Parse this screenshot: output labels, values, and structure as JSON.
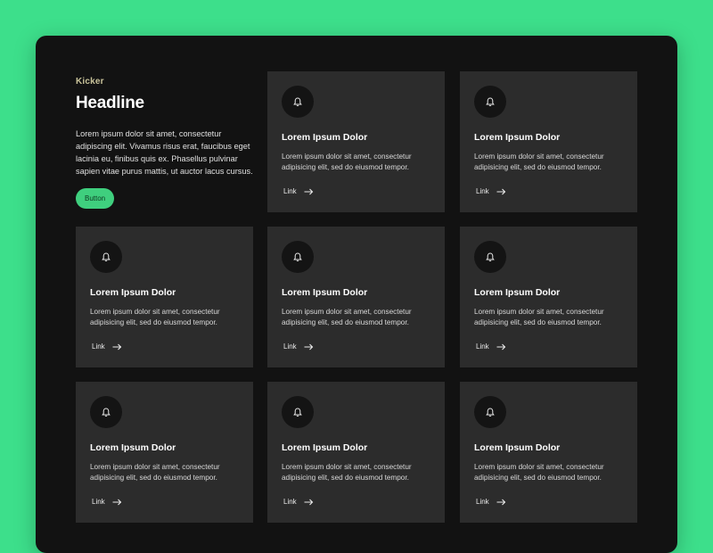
{
  "intro": {
    "kicker": "Kicker",
    "headline": "Headline",
    "body": "Lorem ipsum dolor sit amet, consectetur adipiscing elit. Vivamus risus erat, faucibus eget lacinia eu, finibus quis ex. Phasellus pulvinar sapien vitae purus mattis, ut auctor lacus cursus.",
    "button_label": "Button"
  },
  "colors": {
    "background": "#3ddf8b",
    "frame": "#121212",
    "card": "#2c2c2c",
    "accent": "#3fcf7e",
    "kicker": "#c9c39a"
  },
  "cards": [
    {
      "icon": "bell-icon",
      "title": "Lorem Ipsum Dolor",
      "body": "Lorem ipsum dolor sit amet, consectetur adipisicing elit, sed do eiusmod tempor.",
      "link": "Link"
    },
    {
      "icon": "bell-icon",
      "title": "Lorem Ipsum Dolor",
      "body": "Lorem ipsum dolor sit amet, consectetur adipisicing elit, sed do eiusmod tempor.",
      "link": "Link"
    },
    {
      "icon": "bell-icon",
      "title": "Lorem Ipsum Dolor",
      "body": "Lorem ipsum dolor sit amet, consectetur adipisicing elit, sed do eiusmod tempor.",
      "link": "Link"
    },
    {
      "icon": "bell-icon",
      "title": "Lorem Ipsum Dolor",
      "body": "Lorem ipsum dolor sit amet, consectetur adipisicing elit, sed do eiusmod tempor.",
      "link": "Link"
    },
    {
      "icon": "bell-icon",
      "title": "Lorem Ipsum Dolor",
      "body": "Lorem ipsum dolor sit amet, consectetur adipisicing elit, sed do eiusmod tempor.",
      "link": "Link"
    },
    {
      "icon": "bell-icon",
      "title": "Lorem Ipsum Dolor",
      "body": "Lorem ipsum dolor sit amet, consectetur adipisicing elit, sed do eiusmod tempor.",
      "link": "Link"
    },
    {
      "icon": "bell-icon",
      "title": "Lorem Ipsum Dolor",
      "body": "Lorem ipsum dolor sit amet, consectetur adipisicing elit, sed do eiusmod tempor.",
      "link": "Link"
    },
    {
      "icon": "bell-icon",
      "title": "Lorem Ipsum Dolor",
      "body": "Lorem ipsum dolor sit amet, consectetur adipisicing elit, sed do eiusmod tempor.",
      "link": "Link"
    }
  ]
}
